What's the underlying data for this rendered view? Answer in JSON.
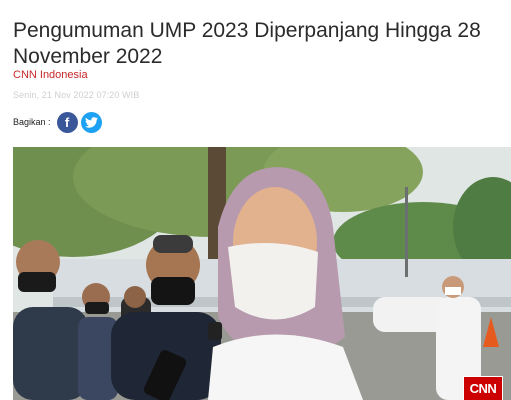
{
  "article": {
    "title": "Pengumuman UMP 2023 Diperpanjang Hingga 28 November 2022",
    "source": "CNN Indonesia",
    "date": "Senin, 21 Nov 2022 07:20 WIB"
  },
  "share": {
    "label": "Bagikan :",
    "facebook_icon": "f",
    "twitter_icon": "twitter-bird"
  },
  "photo": {
    "watermark": "CNN",
    "colors": {
      "brand_red": "#cc0000",
      "facebook": "#3a5899",
      "twitter": "#1da1f2"
    }
  }
}
